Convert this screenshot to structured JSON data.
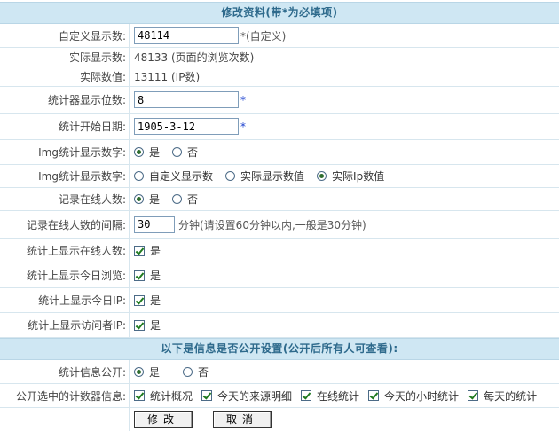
{
  "header1": "修改资料(带*为必填项)",
  "header2": "以下是信息是否公开设置(公开后所有人可查看):",
  "rows": {
    "custom_count": {
      "label": "自定义显示数:",
      "value": "48114",
      "note": "*(自定义)"
    },
    "actual_count": {
      "label": "实际显示数:",
      "value": "48133 (页面的浏览次数)"
    },
    "actual_value": {
      "label": "实际数值:",
      "value": "13111 (IP数)"
    },
    "digits": {
      "label": "统计器显示位数:",
      "value": "8",
      "star": "*"
    },
    "start_date": {
      "label": "统计开始日期:",
      "value": "1905-3-12",
      "star": "*"
    },
    "img_show": {
      "label": "Img统计显示数字:",
      "opt_yes": "是",
      "opt_no": "否"
    },
    "img_source": {
      "label": "Img统计显示数字:",
      "opt1": "自定义显示数",
      "opt2": "实际显示数值",
      "opt3": "实际Ip数值"
    },
    "record_online": {
      "label": "记录在线人数:",
      "opt_yes": "是",
      "opt_no": "否"
    },
    "online_interval": {
      "label": "记录在线人数的间隔:",
      "value": "30",
      "note": "分钟(请设置60分钟以内,一般是30分钟)"
    },
    "show_online": {
      "label": "统计上显示在线人数:",
      "opt": "是"
    },
    "show_today_views": {
      "label": "统计上显示今日浏览:",
      "opt": "是"
    },
    "show_today_ip": {
      "label": "统计上显示今日IP:",
      "opt": "是"
    },
    "show_visitor_ip": {
      "label": "统计上显示访问者IP:",
      "opt": "是"
    },
    "public_info": {
      "label": "统计信息公开:",
      "opt_yes": "是",
      "opt_no": "否"
    },
    "public_items": {
      "label": "公开选中的计数器信息:",
      "opt1": "统计概况",
      "opt2": "今天的来源明细",
      "opt3": "在线统计",
      "opt4": "今天的小时统计",
      "opt5": "每天的统计"
    }
  },
  "buttons": {
    "submit": "修改",
    "cancel": "取消"
  }
}
